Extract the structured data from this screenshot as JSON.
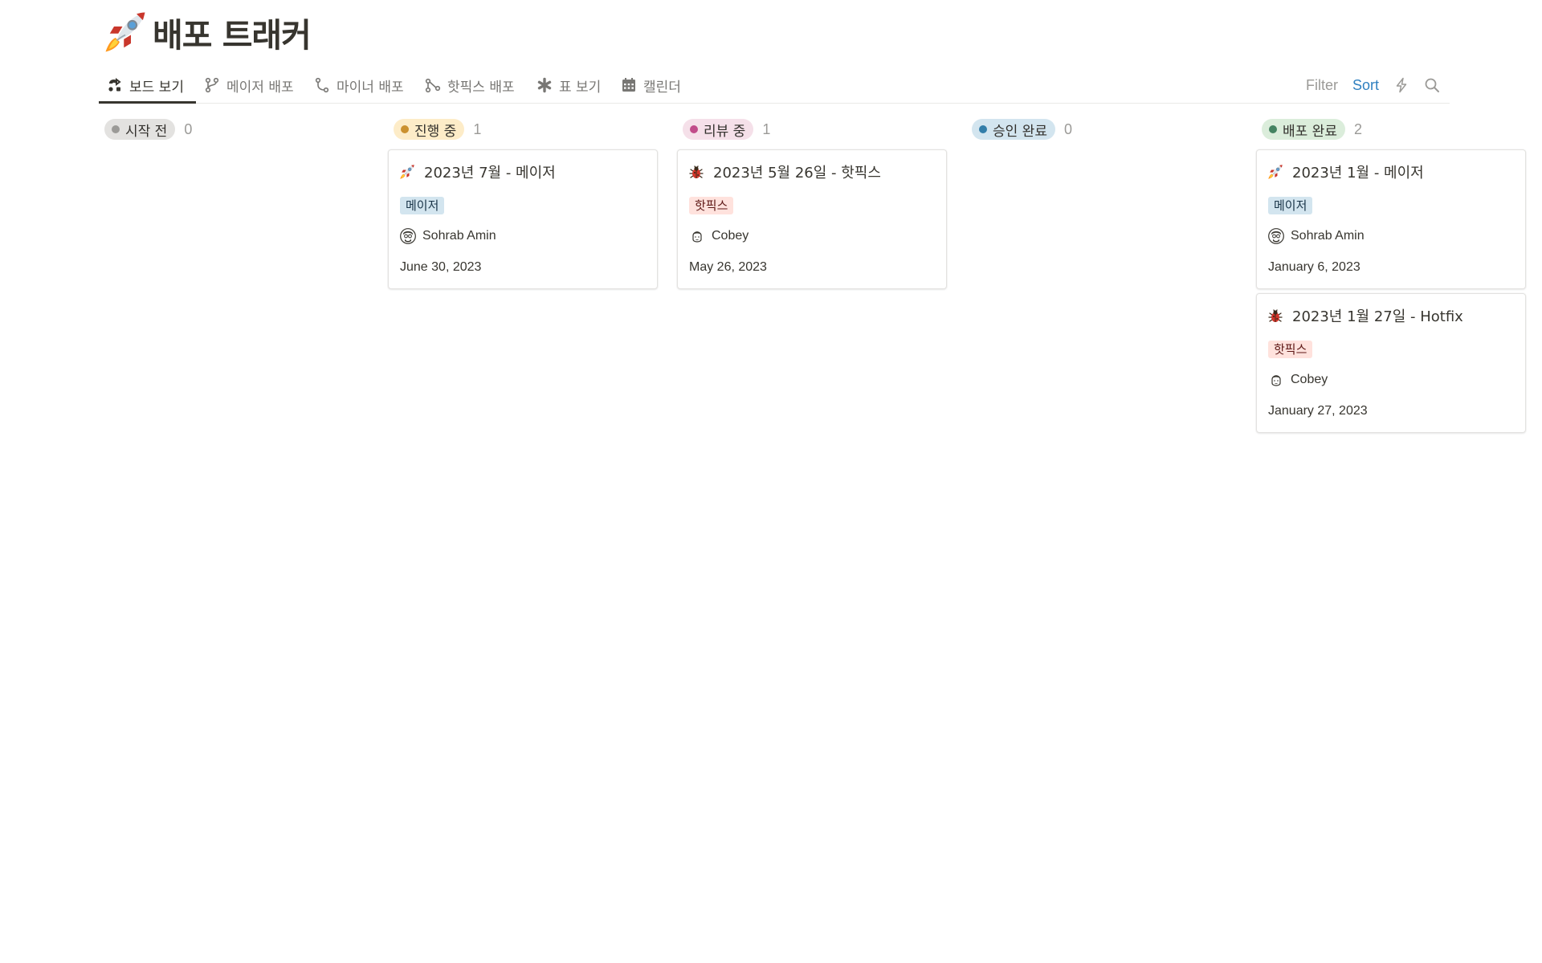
{
  "page": {
    "title": "배포 트래커",
    "icon": "rocket-icon"
  },
  "tabs": [
    {
      "label": "보드 보기",
      "icon": "board-view-icon",
      "active": true
    },
    {
      "label": "메이저 배포",
      "icon": "git-branch-icon",
      "active": false
    },
    {
      "label": "마이너 배포",
      "icon": "git-commit-icon",
      "active": false
    },
    {
      "label": "핫픽스 배포",
      "icon": "git-merge-icon",
      "active": false
    },
    {
      "label": "표 보기",
      "icon": "asterisk-icon",
      "active": false
    },
    {
      "label": "캘린더",
      "icon": "calendar-icon",
      "active": false
    }
  ],
  "toolbar": {
    "filter_label": "Filter",
    "sort_label": "Sort",
    "automation_icon": "lightning-icon",
    "search_icon": "search-icon",
    "accent_color": "#2f80c0"
  },
  "columns": [
    {
      "status": "시작 전",
      "count": "0",
      "pill_color": "#e3e2e0",
      "dot_color": "#9b9a97"
    },
    {
      "status": "진행 중",
      "count": "1",
      "pill_color": "#fdecc8",
      "dot_color": "#cb912f"
    },
    {
      "status": "리뷰 중",
      "count": "1",
      "pill_color": "#f5e0e9",
      "dot_color": "#c14c8a"
    },
    {
      "status": "승인 완료",
      "count": "0",
      "pill_color": "#d3e5ef",
      "dot_color": "#337ea9"
    },
    {
      "status": "배포 완료",
      "count": "2",
      "pill_color": "#dbeddb",
      "dot_color": "#448361"
    }
  ],
  "cards": [
    {
      "title": "2023년 7월 - 메이저",
      "icon": "rocket-icon",
      "tag": "메이저",
      "assignee": "Sohrab Amin",
      "date": "June 30, 2023"
    },
    {
      "title": "2023년 5월 26일  - 핫픽스",
      "icon": "bug-icon",
      "tag": "핫픽스",
      "assignee": "Cobey",
      "date": "May 26, 2023"
    },
    {
      "title": "2023년 1월 - 메이저",
      "icon": "rocket-icon",
      "tag": "메이저",
      "assignee": "Sohrab Amin",
      "date": "January 6, 2023"
    },
    {
      "title": "2023년 1월 27일 - Hotfix",
      "icon": "bug-icon",
      "tag": "핫픽스",
      "assignee": "Cobey",
      "date": "January 27, 2023"
    }
  ]
}
